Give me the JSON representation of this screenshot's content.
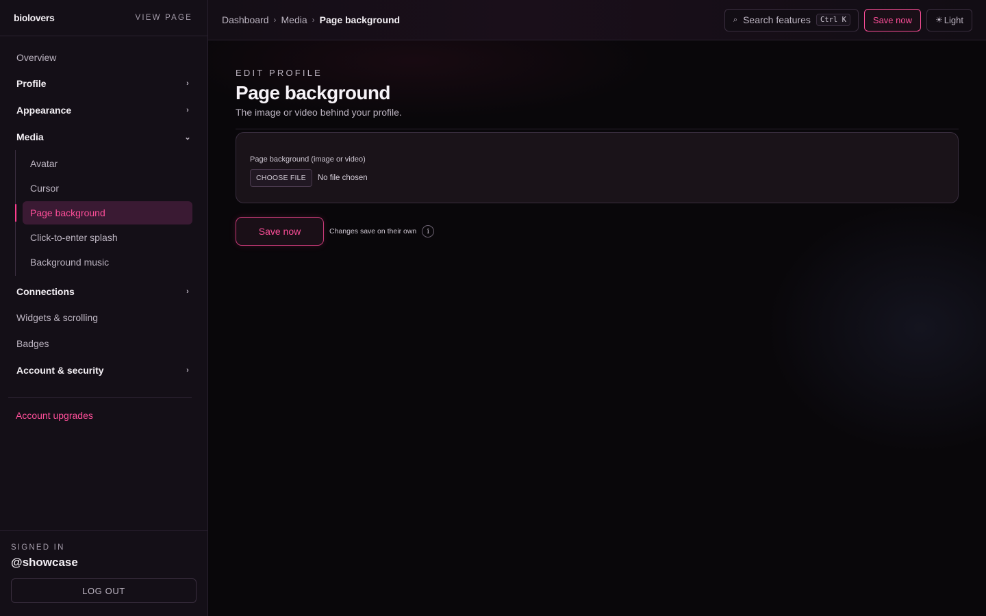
{
  "sidebar": {
    "brand": "biolovers",
    "view_page": "VIEW PAGE",
    "nav": {
      "overview": "Overview",
      "profile": "Profile",
      "appearance": "Appearance",
      "media": "Media",
      "media_items": [
        "Avatar",
        "Cursor",
        "Page background",
        "Click-to-enter splash",
        "Background music"
      ],
      "connections": "Connections",
      "widgets": "Widgets & scrolling",
      "badges": "Badges",
      "account_security": "Account & security"
    },
    "upgrades": "Account upgrades",
    "signed_in_label": "SIGNED IN",
    "handle": "@showcase",
    "logout": "LOG OUT"
  },
  "topbar": {
    "breadcrumbs": [
      "Dashboard",
      "Media",
      "Page background"
    ],
    "search_label": "Search features",
    "shortcut": "Ctrl K",
    "save_label": "Save now",
    "theme_label": "Light"
  },
  "main": {
    "eyebrow": "EDIT PROFILE",
    "title": "Page background",
    "subtitle": "The image or video behind your profile.",
    "field_label": "Page background (image or video)",
    "choose_file": "CHOOSE FILE",
    "no_file": "No file chosen",
    "save_label": "Save now",
    "auto_note": "Changes save on their own",
    "info": "i"
  },
  "colors": {
    "accent": "#ff4f9a",
    "sidebar_bg": "#140f17",
    "page_bg": "#09070a",
    "border": "#2a2130"
  },
  "icons": {
    "chevron_right": "chevron-right-icon",
    "chevron_down": "chevron-down-icon",
    "search": "search-icon",
    "sun": "sun-icon",
    "info": "info-icon"
  }
}
